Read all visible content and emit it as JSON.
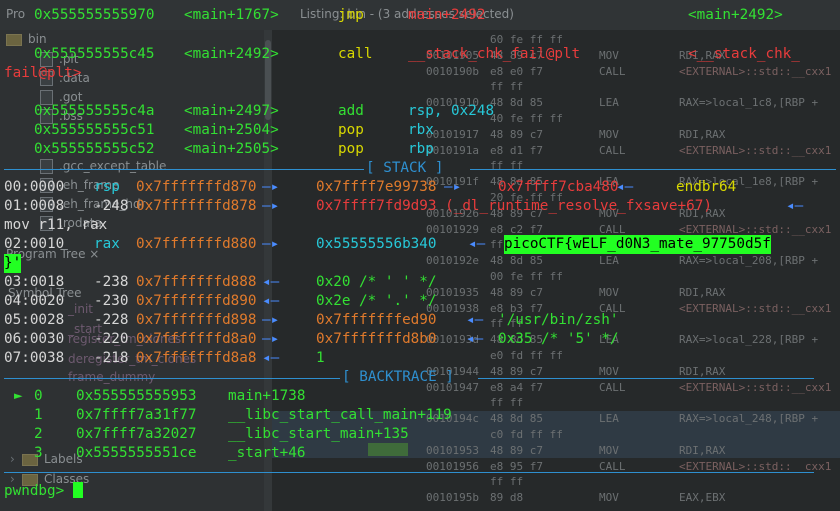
{
  "window": {
    "program_tree_title": "Program Tree ×",
    "listing_title": "Listing: bin - (3 addresses selected)",
    "symbol_tree_title": "Symbol Tree",
    "prog_label": "Pro"
  },
  "tree_items": [
    {
      "name": "bin",
      "kind": "folder"
    },
    {
      "name": ".plt",
      "kind": "file"
    },
    {
      "name": ".data",
      "kind": "file"
    },
    {
      "name": ".got",
      "kind": "file"
    },
    {
      "name": ".bss",
      "kind": "file"
    },
    {
      "name": ".gcc_except_table",
      "kind": "file"
    },
    {
      "name": ".eh_frame",
      "kind": "file"
    },
    {
      "name": ".eh_frame_hdr",
      "kind": "file"
    },
    {
      "name": ".rodata",
      "kind": "file"
    }
  ],
  "symbol_items": [
    "frame_dummy",
    "register_tm_clones",
    "deregister_tm_clones",
    "_start",
    "_init"
  ],
  "symbol_bottom": {
    "labels": "Labels",
    "classes": "Classes"
  },
  "listing_rows": [
    {
      "addr": "",
      "bytes": "60 fe ff ff",
      "mn": "",
      "op": ""
    },
    {
      "addr": "00101905",
      "bytes": "48 89 c7",
      "mn": "MOV",
      "op": "RDI,RAX"
    },
    {
      "addr": "0010190b",
      "bytes": "e8 e0 f7",
      "mn": "CALL",
      "op": "<EXTERNAL>::std::__cxx1"
    },
    {
      "addr": "",
      "bytes": "ff ff",
      "mn": "",
      "op": ""
    },
    {
      "addr": "00101910",
      "bytes": "48 8d 85",
      "mn": "LEA",
      "op": "RAX=>local_1c8,[RBP +"
    },
    {
      "addr": "",
      "bytes": "40 fe ff ff",
      "mn": "",
      "op": ""
    },
    {
      "addr": "00101917",
      "bytes": "48 89 c7",
      "mn": "MOV",
      "op": "RDI,RAX"
    },
    {
      "addr": "0010191a",
      "bytes": "e8 d1 f7",
      "mn": "CALL",
      "op": "<EXTERNAL>::std::__cxx1"
    },
    {
      "addr": "",
      "bytes": "ff ff",
      "mn": "",
      "op": ""
    },
    {
      "addr": "0010191f",
      "bytes": "48 8d 85",
      "mn": "LEA",
      "op": "RAX=>local_1e8,[RBP +"
    },
    {
      "addr": "",
      "bytes": "20 fe ff ff",
      "mn": "",
      "op": ""
    },
    {
      "addr": "00101926",
      "bytes": "48 89 c7",
      "mn": "MOV",
      "op": "RDI,RAX"
    },
    {
      "addr": "00101929",
      "bytes": "e8 c2 f7",
      "mn": "CALL",
      "op": "<EXTERNAL>::std::__cxx1"
    },
    {
      "addr": "",
      "bytes": "ff ff",
      "mn": "",
      "op": ""
    },
    {
      "addr": "0010192e",
      "bytes": "48 8d 85",
      "mn": "LEA",
      "op": "RAX=>local_208,[RBP +"
    },
    {
      "addr": "",
      "bytes": "00 fe ff ff",
      "mn": "",
      "op": ""
    },
    {
      "addr": "00101935",
      "bytes": "48 89 c7",
      "mn": "MOV",
      "op": "RDI,RAX"
    },
    {
      "addr": "00101938",
      "bytes": "e8 b3 f7",
      "mn": "CALL",
      "op": "<EXTERNAL>::std::__cxx1"
    },
    {
      "addr": "",
      "bytes": "ff ff",
      "mn": "",
      "op": ""
    },
    {
      "addr": "0010193d",
      "bytes": "48 8d 85",
      "mn": "LEA",
      "op": "RAX=>local_228,[RBP +"
    },
    {
      "addr": "",
      "bytes": "e0 fd ff ff",
      "mn": "",
      "op": ""
    },
    {
      "addr": "00101944",
      "bytes": "48 89 c7",
      "mn": "MOV",
      "op": "RDI,RAX"
    },
    {
      "addr": "00101947",
      "bytes": "e8 a4 f7",
      "mn": "CALL",
      "op": "<EXTERNAL>::std::__cxx1"
    },
    {
      "addr": "",
      "bytes": "ff ff",
      "mn": "",
      "op": ""
    },
    {
      "addr": "0010194c",
      "bytes": "48 8d 85",
      "mn": "LEA",
      "op": "RAX=>local_248,[RBP +"
    },
    {
      "addr": "",
      "bytes": "c0 fd ff ff",
      "mn": "",
      "op": ""
    },
    {
      "addr": "00101953",
      "bytes": "48 89 c7",
      "mn": "MOV",
      "op": "RDI,RAX"
    },
    {
      "addr": "00101956",
      "bytes": "e8 95 f7",
      "mn": "CALL",
      "op": "<EXTERNAL>::std::__cxx1"
    },
    {
      "addr": "",
      "bytes": "ff ff",
      "mn": "",
      "op": ""
    },
    {
      "addr": "0010195b",
      "bytes": "89 d8",
      "mn": "MOV",
      "op": "EAX,EBX"
    }
  ],
  "terminal": {
    "code": [
      {
        "addr": "0x555555555970",
        "sym": "<main+1767>",
        "mn": "jmp",
        "op1": "main+2492",
        "op2": "<main+2492>"
      },
      {
        "addr": "0x555555555c45",
        "sym": "<main+2492>",
        "mn": "call",
        "op1": "__stack_chk_fail@plt",
        "op2": "<__stack_chk_"
      },
      {
        "wrap": "fail@plt>"
      },
      {
        "addr": "0x555555555c4a",
        "sym": "<main+2497>",
        "mn": "add",
        "op1": "rsp, 0x248"
      },
      {
        "addr": "0x555555555c51",
        "sym": "<main+2504>",
        "mn": "pop",
        "op1": "rbx"
      },
      {
        "addr": "0x555555555c52",
        "sym": "<main+2505>",
        "mn": "pop",
        "op1": "rbp"
      }
    ],
    "stack_label": "[ STACK ]",
    "stack": [
      {
        "idx": "00:0000",
        "reg": "rsp",
        "addr": "0x7fffffffd870",
        "v1": "0x7ffff7e99738",
        "v2": "0x7ffff7cba480",
        "v3": "endbr64"
      },
      {
        "idx": "01:0008",
        "off": "-248",
        "addr": "0x7fffffffd878",
        "v1": "0x7ffff7fd9d93 (_dl_runtime_resolve_fxsave+67)",
        "arrow": "◂—"
      },
      {
        "wrap": "mov r11, rax"
      },
      {
        "idx": "02:0010",
        "reg": "rax",
        "addr": "0x7fffffffd880",
        "v1": "0x55555556b340",
        "flag": "picoCTF{wELF_d0N3_mate_97750d5f"
      },
      {
        "wrap_flag": "}'"
      },
      {
        "idx": "03:0018",
        "off": "-238",
        "addr": "0x7fffffffd888",
        "v1": "0x20 /* ' ' */"
      },
      {
        "idx": "04:0020",
        "off": "-230",
        "addr": "0x7fffffffd890",
        "v1": "0x2e /* '.' */"
      },
      {
        "idx": "05:0028",
        "off": "-228",
        "addr": "0x7fffffffd898",
        "v1": "0x7fffffffed90",
        "v2": "'/usr/bin/zsh'"
      },
      {
        "idx": "06:0030",
        "off": "-220",
        "addr": "0x7fffffffd8a0",
        "v1": "0x7fffffffd8b0",
        "v2": "0x35 /* '5' */"
      },
      {
        "idx": "07:0038",
        "off": "-218",
        "addr": "0x7fffffffd8a8",
        "v1": "1"
      }
    ],
    "backtrace_label": "[ BACKTRACE ]",
    "backtrace": [
      {
        "marker": "►",
        "n": "0",
        "addr": "0x555555555953",
        "sym": "main+1738"
      },
      {
        "marker": "",
        "n": "1",
        "addr": "0x7ffff7a31f77",
        "sym": "__libc_start_call_main+119"
      },
      {
        "marker": "",
        "n": "2",
        "addr": "0x7ffff7a32027",
        "sym": "__libc_start_main+135"
      },
      {
        "marker": "",
        "n": "3",
        "addr": "0x5555555551ce",
        "sym": "_start+46"
      }
    ],
    "prompt": "pwndbg>"
  }
}
